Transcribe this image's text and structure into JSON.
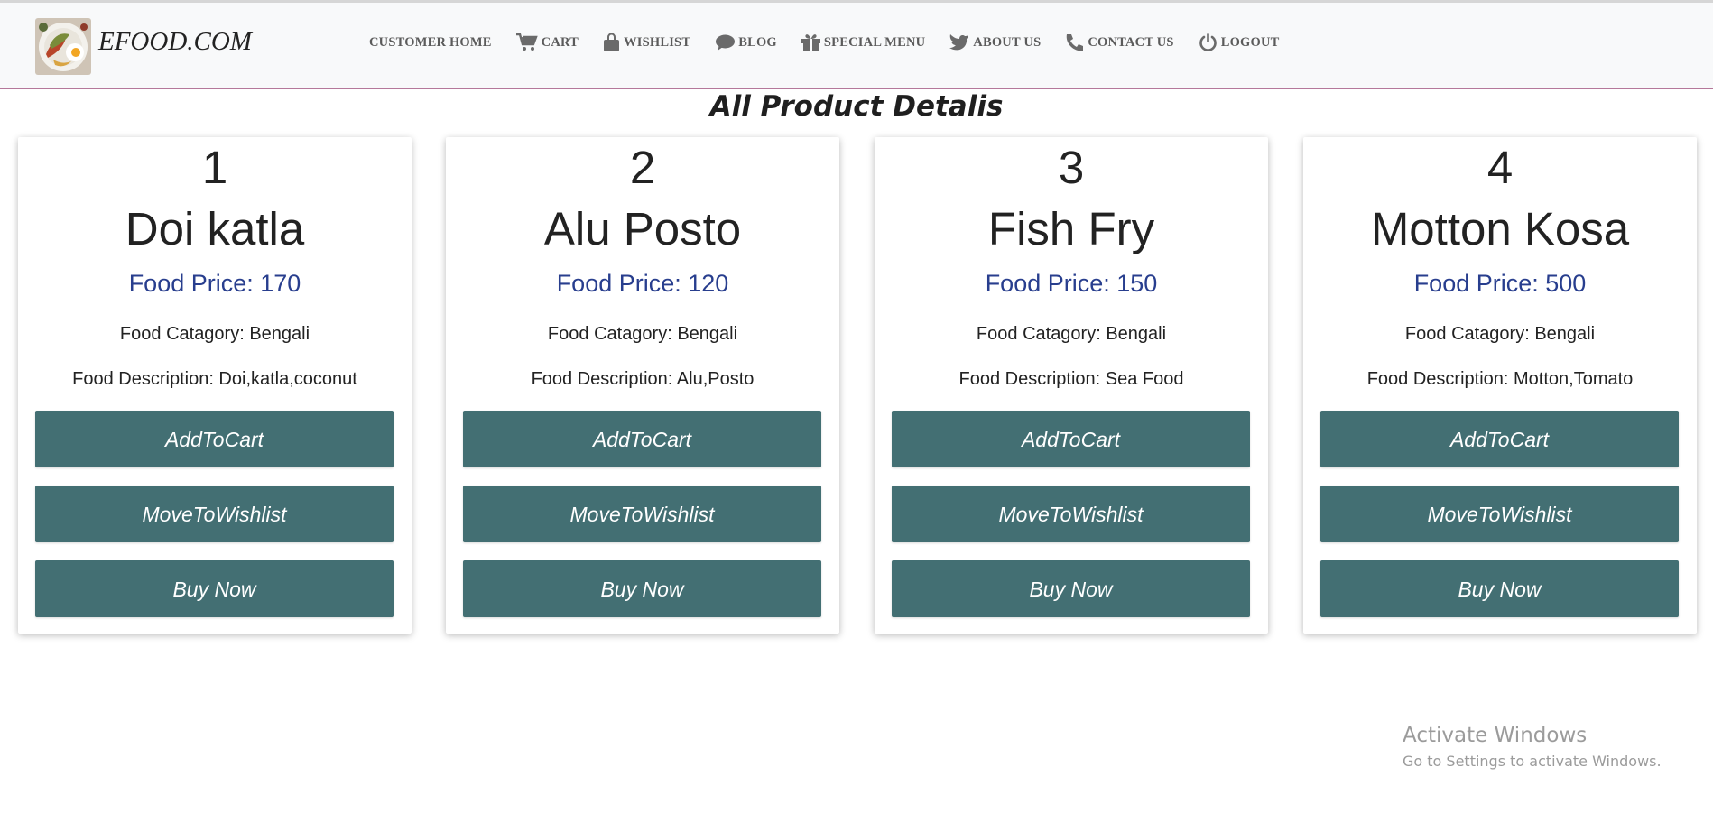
{
  "brand": {
    "name": "EFOOD.COM"
  },
  "nav": {
    "customer_home": "CUSTOMER HOME",
    "cart": "CART",
    "wishlist": "WISHLIST",
    "blog": "BLOG",
    "special_menu": "SPECIAL MENU",
    "about_us": "ABOUT US",
    "contact_us": "CONTACT US",
    "logout": "LOGOUT"
  },
  "page": {
    "title": "All Product Detalis"
  },
  "products": [
    {
      "number": "1",
      "name": "Doi katla",
      "price": "Food Price: 170",
      "category": "Food Catagory: Bengali",
      "description": "Food Description: Doi,katla,coconut",
      "add_to_cart": "AddToCart",
      "move_to_wishlist": "MoveToWishlist",
      "buy_now": "Buy Now"
    },
    {
      "number": "2",
      "name": "Alu Posto",
      "price": "Food Price: 120",
      "category": "Food Catagory: Bengali",
      "description": "Food Description: Alu,Posto",
      "add_to_cart": "AddToCart",
      "move_to_wishlist": "MoveToWishlist",
      "buy_now": "Buy Now"
    },
    {
      "number": "3",
      "name": "Fish Fry",
      "price": "Food Price: 150",
      "category": "Food Catagory: Bengali",
      "description": "Food Description: Sea Food",
      "add_to_cart": "AddToCart",
      "move_to_wishlist": "MoveToWishlist",
      "buy_now": "Buy Now"
    },
    {
      "number": "4",
      "name": "Motton Kosa",
      "price": "Food Price: 500",
      "category": "Food Catagory: Bengali",
      "description": "Food Description: Motton,Tomato",
      "add_to_cart": "AddToCart",
      "move_to_wishlist": "MoveToWishlist",
      "buy_now": "Buy Now"
    }
  ],
  "watermark": {
    "title": "Activate Windows",
    "subtitle": "Go to Settings to activate Windows."
  },
  "colors": {
    "button": "#436f73",
    "price": "#283e8e",
    "navbar": "#f8f9fa",
    "navbar_border": "#b5789a"
  },
  "icons": [
    "cart-icon",
    "shopping-bag-icon",
    "comment-icon",
    "gift-icon",
    "bird-icon",
    "phone-icon",
    "power-icon"
  ]
}
